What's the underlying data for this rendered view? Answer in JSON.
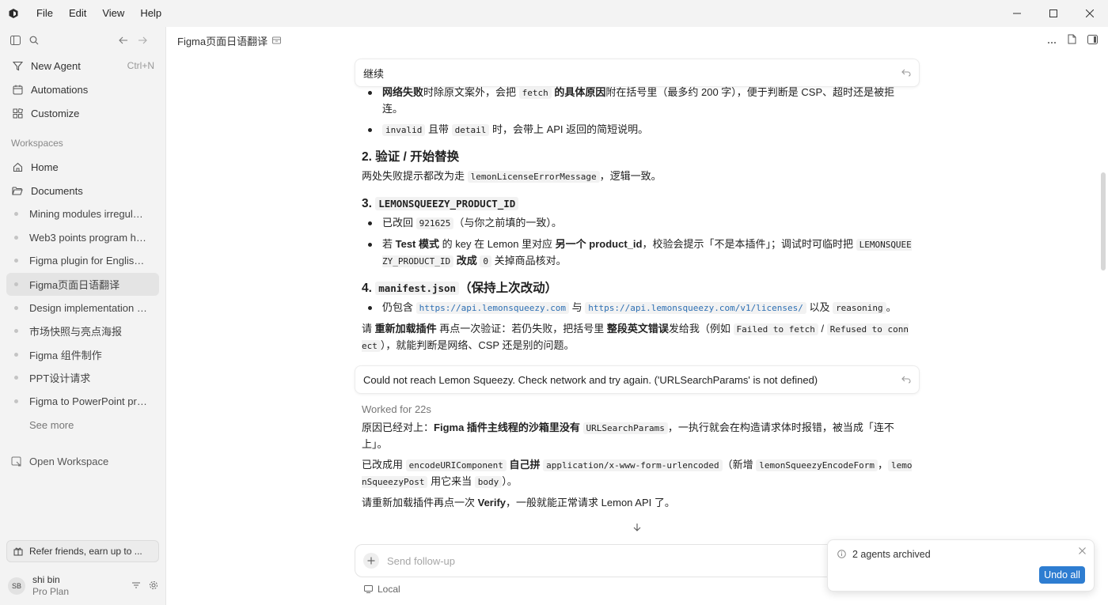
{
  "menu": [
    "File",
    "Edit",
    "View",
    "Help"
  ],
  "sidebar": {
    "new_agent": "New Agent",
    "new_agent_shortcut": "Ctrl+N",
    "automations": "Automations",
    "customize": "Customize",
    "workspaces_label": "Workspaces",
    "home": "Home",
    "documents": "Documents",
    "chats": [
      "Mining modules irregular ...",
      "Web3 points program her...",
      "Figma plugin for English t...",
      "Figma页面日语翻译",
      "Design implementation fo...",
      "市场快照与亮点海报",
      "Figma 组件制作",
      "PPT设计请求",
      "Figma to PowerPoint prese..."
    ],
    "active_chat_index": 3,
    "see_more": "See more",
    "open_workspace": "Open Workspace",
    "refer": "Refer friends, earn up to ...",
    "user_initials": "SB",
    "user_name": "shi bin",
    "user_plan": "Pro Plan"
  },
  "main": {
    "title": "Figma页面日语翻译",
    "msg1": "继续",
    "msg2": "Could not reach Lemon Squeezy. Check network and try again. ('URLSearchParams' is not defined)",
    "worked_for": "Worked for 22s",
    "followup_placeholder": "Send follow-up",
    "local": "Local"
  },
  "response1": {
    "b1_bold1": "网络失败",
    "b1_t1": "时除原文案外，会把 ",
    "b1_code": "fetch",
    "b1_bold2": " 的具体原因",
    "b1_t2": "附在括号里（最多约 200 字），便于判断是 CSP、超时还是被拒连。",
    "b2_code1": "invalid",
    "b2_t1": " 且带 ",
    "b2_code2": "detail",
    "b2_t2": " 时，会带上 API 返回的简短说明。",
    "h2": "2. 验证 / 开始替换",
    "p2_t1": "两处失败提示都改为走 ",
    "p2_code": "lemonLicenseErrorMessage",
    "p2_t2": "，逻辑一致。",
    "h3_num": "3. ",
    "h3_code": "LEMONSQUEEZY_PRODUCT_ID",
    "b3_t1": "已改回 ",
    "b3_code": "921625",
    "b3_t2": "（与你之前填的一致）。",
    "b4_t1": "若 ",
    "b4_bold1": "Test 模式",
    "b4_t2": " 的 key 在 Lemon 里对应 ",
    "b4_bold2": "另一个 product_id",
    "b4_t3": "，校验会提示「不是本插件」；调试时可临时把 ",
    "b4_code1": "LEMONSQUEEZY_PRODUCT_ID",
    "b4_bold3": " 改成 ",
    "b4_code2": "0",
    "b4_t4": " 关掉商品核对。",
    "h4_num": "4. ",
    "h4_code": "manifest.json",
    "h4_t": "（保持上次改动）",
    "b5_t1": "仍包含 ",
    "b5_link1": "https://api.lemonsqueezy.com",
    "b5_t2": " 与 ",
    "b5_link2": "https://api.lemonsqueezy.com/v1/licenses/",
    "b5_t3": " 以及 ",
    "b5_code": "reasoning",
    "b5_t4": "。",
    "p5_t1": "请 ",
    "p5_bold1": "重新加载插件",
    "p5_t2": " 再点一次验证：若仍失败，把括号里 ",
    "p5_bold2": "整段英文错误",
    "p5_t3": "发给我（例如 ",
    "p5_code1": "Failed to fetch",
    "p5_t4": " / ",
    "p5_code2": "Refused to connect",
    "p5_t5": "），就能判断是网络、CSP 还是别的问题。"
  },
  "response2": {
    "p1_t1": "原因已经对上：",
    "p1_bold": "Figma 插件主线程的沙箱里没有 ",
    "p1_code": "URLSearchParams",
    "p1_t2": "，一执行就会在构造请求体时报错，被当成「连不上」。",
    "p2_t1": "已改成用 ",
    "p2_code1": "encodeURIComponent",
    "p2_bold": " 自己拼 ",
    "p2_code2": "application/x-www-form-urlencoded",
    "p2_t2": "（新增 ",
    "p2_code3": "lemonSqueezyEncodeForm",
    "p2_t3": "，",
    "p2_code4": "lemonSqueezyPost",
    "p2_t4": " 用它来当 ",
    "p2_code5": "body",
    "p2_t5": "）。",
    "p3_t1": "请重新加载插件再点一次 ",
    "p3_bold": "Verify",
    "p3_t2": "，一般就能正常请求 Lemon API 了。"
  },
  "toast": {
    "text": "2 agents archived",
    "button": "Undo all"
  }
}
